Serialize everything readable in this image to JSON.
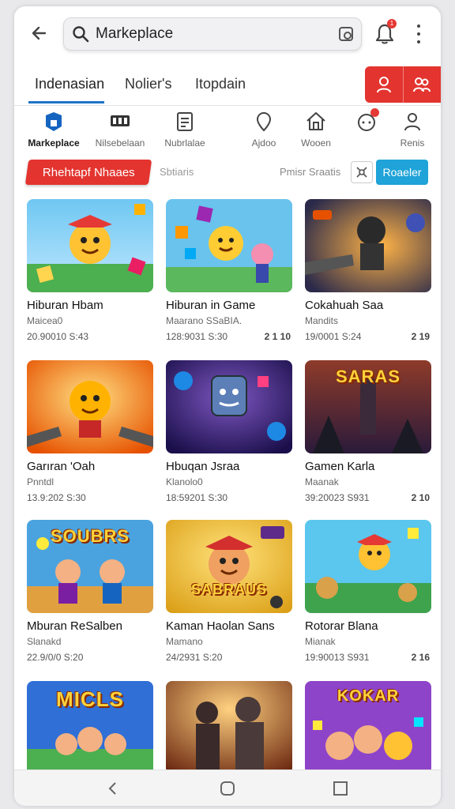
{
  "search": {
    "value": "Markeplace"
  },
  "header": {
    "notification_badge": "1"
  },
  "tabs": [
    {
      "label": "Indenasian"
    },
    {
      "label": "Nolier's"
    },
    {
      "label": "Itopdain"
    }
  ],
  "categories": [
    {
      "label": "Markeplace",
      "icon": "marketplace-icon"
    },
    {
      "label": "Nilsebelaan",
      "icon": "grid-icon"
    },
    {
      "label": "Nubrlalae",
      "icon": "document-icon"
    },
    {
      "label": "Ajdoo",
      "icon": "location-pin-icon"
    },
    {
      "label": "Wooen",
      "icon": "home-icon"
    },
    {
      "label": "",
      "icon": "chat-bell-icon"
    },
    {
      "label": "Renis",
      "icon": "person-icon"
    }
  ],
  "filters": {
    "primary": "Rhehtapf Nhaaes",
    "secondary": "Sbtiaris",
    "right_label": "Pmisr Sraatis",
    "action": "Roaeler"
  },
  "colors": {
    "accent_red": "#e3342f",
    "accent_blue": "#1fa3d8",
    "tab_underline": "#1e74c7"
  },
  "cards": [
    {
      "title": "Hiburan Hbam",
      "subtitle": "Maicea0",
      "meta": "20.90010 S:43",
      "count": ""
    },
    {
      "title": "Hiburan in Game",
      "subtitle": "Maarano SSaBIA.",
      "meta": "128:9031 S:30",
      "count": "2 1 10"
    },
    {
      "title": "Cokahuah Saa",
      "subtitle": "Mandits",
      "meta": "19/0001 S:24",
      "count": "2 19"
    },
    {
      "title": "Garıran 'Oah",
      "subtitle": "Pnntdl",
      "meta": "13.9:202 S:30",
      "count": ""
    },
    {
      "title": "Hbuqan Jsraa",
      "subtitle": "Klanolo0",
      "meta": "18:59201 S:30",
      "count": ""
    },
    {
      "title": "Gamen Karla",
      "subtitle": "Maanak",
      "meta": "39:20023 S931",
      "count": "2 10"
    },
    {
      "title": "Mburan ReSalben",
      "subtitle": "Slanakd",
      "meta": "22.9/0/0 S:20",
      "count": ""
    },
    {
      "title": "Kaman Haolan Sans",
      "subtitle": "Mamano",
      "meta": "24/2931 S:20",
      "count": ""
    },
    {
      "title": "Rotorar Blana",
      "subtitle": "Mianak",
      "meta": "19:90013 S931",
      "count": "2 16"
    },
    {
      "title": "",
      "subtitle": "",
      "meta": "",
      "count": ""
    },
    {
      "title": "",
      "subtitle": "",
      "meta": "",
      "count": ""
    },
    {
      "title": "",
      "subtitle": "",
      "meta": "",
      "count": ""
    }
  ],
  "banners": [
    "SARAS",
    "SOUBRS",
    "SABRAUS",
    "MICLS",
    "KOKAR"
  ]
}
